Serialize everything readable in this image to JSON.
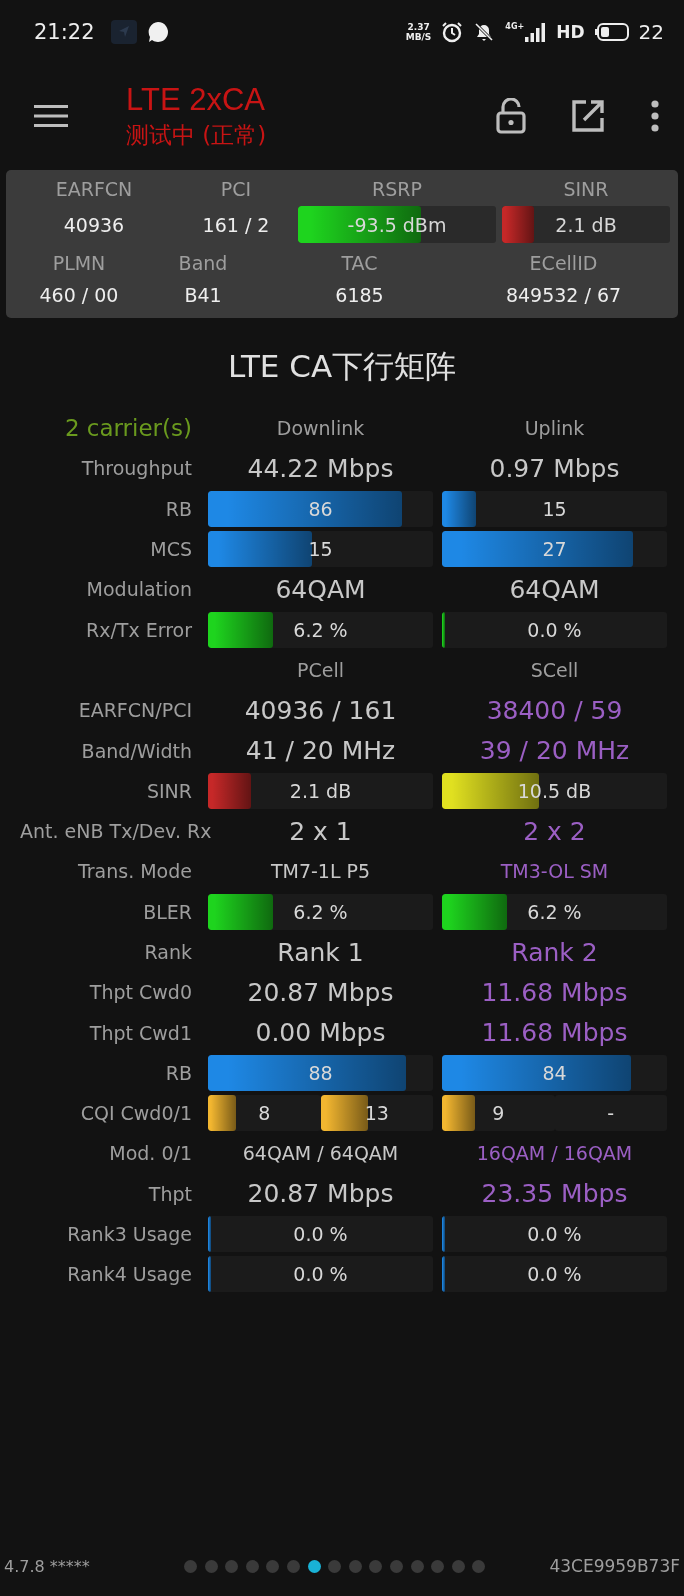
{
  "status_bar": {
    "time": "21:22",
    "speed_value": "2.37",
    "speed_unit": "MB/S",
    "network": "4G+",
    "hd": "HD",
    "battery": "22"
  },
  "header": {
    "title": "LTE 2xCA",
    "subtitle": "测试中 (正常)"
  },
  "summary": {
    "top": [
      {
        "label": "EARFCN",
        "kind": "text",
        "value": "40936"
      },
      {
        "label": "PCI",
        "kind": "text",
        "value": "161 / 2"
      },
      {
        "label": "RSRP",
        "kind": "bar",
        "value": "-93.5 dBm",
        "level": 0.62,
        "color": "#1ed41e"
      },
      {
        "label": "SINR",
        "kind": "bar",
        "value": "2.1 dB",
        "level": 0.19,
        "color": "#c62828"
      }
    ],
    "bottom": [
      {
        "label": "PLMN",
        "value": "460 / 00"
      },
      {
        "label": "Band",
        "value": "B41"
      },
      {
        "label": "TAC",
        "value": "6185"
      },
      {
        "label": "ECellID",
        "value": "849532 / 67"
      }
    ]
  },
  "matrix": {
    "title": "LTE CA下行矩阵",
    "carriers": "2 carrier(s)",
    "rows": [
      {
        "label": "",
        "cells": [
          {
            "kind": "header",
            "text": "Downlink"
          },
          {
            "kind": "header",
            "text": "Uplink"
          }
        ]
      },
      {
        "label": "Throughput",
        "cells": [
          {
            "kind": "big",
            "text": "44.22 Mbps",
            "highlighted": false
          },
          {
            "kind": "big",
            "text": "0.97 Mbps",
            "highlighted": false
          }
        ]
      },
      {
        "label": "RB",
        "cells": [
          {
            "kind": "bar",
            "text": "86",
            "level": 0.86,
            "color": "#1e88e5"
          },
          {
            "kind": "bar",
            "text": "15",
            "level": 0.15,
            "color": "#1e88e5"
          }
        ]
      },
      {
        "label": "MCS",
        "cells": [
          {
            "kind": "bar",
            "text": "15",
            "level": 0.46,
            "color": "#1e88e5"
          },
          {
            "kind": "bar",
            "text": "27",
            "level": 0.85,
            "color": "#1e88e5"
          }
        ]
      },
      {
        "label": "Modulation",
        "cells": [
          {
            "kind": "big",
            "text": "64QAM",
            "highlighted": false
          },
          {
            "kind": "big",
            "text": "64QAM",
            "highlighted": false
          }
        ]
      },
      {
        "label": "Rx/Tx Error",
        "cells": [
          {
            "kind": "bar",
            "text": "6.2 %",
            "level": 0.29,
            "color": "#1ed41e"
          },
          {
            "kind": "bar",
            "text": "0.0 %",
            "level": 0.01,
            "color": "#1ed41e"
          }
        ]
      },
      {
        "label": "",
        "cells": [
          {
            "kind": "header",
            "text": "PCell"
          },
          {
            "kind": "header",
            "text": "SCell"
          }
        ]
      },
      {
        "label": "EARFCN/PCI",
        "cells": [
          {
            "kind": "big",
            "text": "40936 / 161",
            "highlighted": false
          },
          {
            "kind": "big",
            "text": "38400 / 59",
            "highlighted": true
          }
        ]
      },
      {
        "label": "Band/Width",
        "cells": [
          {
            "kind": "big",
            "text": "41 / 20 MHz",
            "highlighted": false
          },
          {
            "kind": "big",
            "text": "39 / 20 MHz",
            "highlighted": true
          }
        ]
      },
      {
        "label": "SINR",
        "cells": [
          {
            "kind": "bar",
            "text": "2.1 dB",
            "level": 0.19,
            "color": "#c62828"
          },
          {
            "kind": "bar",
            "text": "10.5 dB",
            "level": 0.43,
            "color": "#e0e020"
          }
        ]
      },
      {
        "label": "Ant. eNB Tx/Dev. Rx",
        "cells": [
          {
            "kind": "big",
            "text": "2 x 1",
            "highlighted": false
          },
          {
            "kind": "big",
            "text": "2 x 2",
            "highlighted": true
          }
        ]
      },
      {
        "label": "Trans. Mode",
        "cells": [
          {
            "kind": "small",
            "text": "TM7-1L P5",
            "highlighted": false
          },
          {
            "kind": "small",
            "text": "TM3-OL SM",
            "highlighted": true
          }
        ]
      },
      {
        "label": "BLER",
        "cells": [
          {
            "kind": "bar",
            "text": "6.2 %",
            "level": 0.29,
            "color": "#1ed41e"
          },
          {
            "kind": "bar",
            "text": "6.2 %",
            "level": 0.29,
            "color": "#1ed41e"
          }
        ]
      },
      {
        "label": "Rank",
        "cells": [
          {
            "kind": "big",
            "text": "Rank 1",
            "highlighted": false
          },
          {
            "kind": "big",
            "text": "Rank 2",
            "highlighted": true
          }
        ]
      },
      {
        "label": "Thpt Cwd0",
        "cells": [
          {
            "kind": "big",
            "text": "20.87 Mbps",
            "highlighted": false
          },
          {
            "kind": "big",
            "text": "11.68 Mbps",
            "highlighted": true
          }
        ]
      },
      {
        "label": "Thpt Cwd1",
        "cells": [
          {
            "kind": "big",
            "text": "0.00 Mbps",
            "highlighted": false
          },
          {
            "kind": "big",
            "text": "11.68 Mbps",
            "highlighted": true
          }
        ]
      },
      {
        "label": "RB",
        "cells": [
          {
            "kind": "bar",
            "text": "88",
            "level": 0.88,
            "color": "#1e88e5"
          },
          {
            "kind": "bar",
            "text": "84",
            "level": 0.84,
            "color": "#1e88e5"
          }
        ]
      },
      {
        "label": "CQI Cwd0/1",
        "cells": [
          {
            "kind": "pair",
            "parts": [
              {
                "text": "8",
                "level": 0.25,
                "color": "#f2b630"
              },
              {
                "text": "13",
                "level": 0.42,
                "color": "#f2b630"
              }
            ]
          },
          {
            "kind": "pair",
            "parts": [
              {
                "text": "9",
                "level": 0.29,
                "color": "#f2b630"
              },
              {
                "text": "-"
              }
            ]
          }
        ]
      },
      {
        "label": "Mod. 0/1",
        "cells": [
          {
            "kind": "small",
            "text": "64QAM / 64QAM",
            "highlighted": false
          },
          {
            "kind": "small",
            "text": "16QAM / 16QAM",
            "highlighted": true
          }
        ]
      },
      {
        "label": "Thpt",
        "cells": [
          {
            "kind": "big",
            "text": "20.87 Mbps",
            "highlighted": false
          },
          {
            "kind": "big",
            "text": "23.35 Mbps",
            "highlighted": true
          }
        ]
      },
      {
        "label": "Rank3 Usage",
        "cells": [
          {
            "kind": "bar",
            "text": "0.0 %",
            "level": 0.01,
            "color": "#1e88e5"
          },
          {
            "kind": "bar",
            "text": "0.0 %",
            "level": 0.01,
            "color": "#1e88e5"
          }
        ]
      },
      {
        "label": "Rank4 Usage",
        "cells": [
          {
            "kind": "bar",
            "text": "0.0 %",
            "level": 0.01,
            "color": "#1e88e5"
          },
          {
            "kind": "bar",
            "text": "0.0 %",
            "level": 0.01,
            "color": "#1e88e5"
          }
        ]
      }
    ]
  },
  "footer": {
    "version": "4.7.8 *****",
    "device_id": "43CE9959B73F",
    "page_dots": [
      {
        "selected": false
      },
      {
        "selected": false
      },
      {
        "selected": false
      },
      {
        "selected": false
      },
      {
        "selected": false
      },
      {
        "selected": false
      },
      {
        "selected": true
      },
      {
        "selected": false
      },
      {
        "selected": false
      },
      {
        "selected": false
      },
      {
        "selected": false
      },
      {
        "selected": false
      },
      {
        "selected": false
      },
      {
        "selected": false
      },
      {
        "selected": false
      }
    ]
  }
}
